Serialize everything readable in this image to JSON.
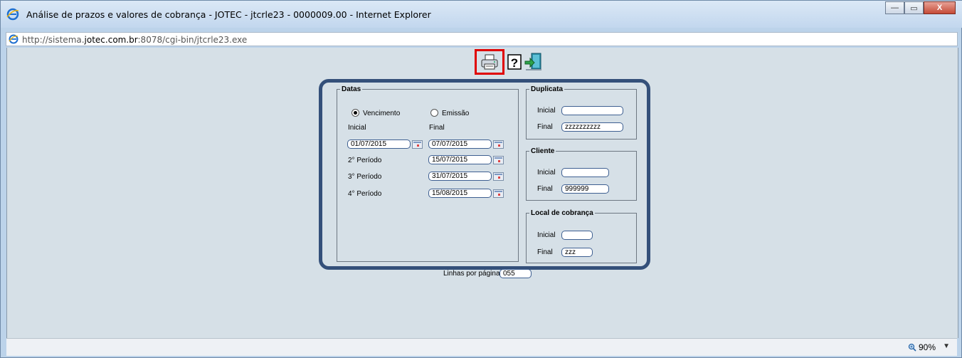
{
  "window": {
    "title": "Análise de prazos e valores de cobrança - JOTEC - jtcrle23 - 0000009.00 - Internet Explorer",
    "minimize": "—",
    "maximize": "▭",
    "close": "X"
  },
  "address": {
    "prefix": "http://sistema.",
    "domain": "jotec.com.br",
    "suffix": ":8078/cgi-bin/jtcrle23.exe"
  },
  "toolbar": {
    "print_icon": "printer-icon",
    "help_icon": "help-icon",
    "exit_icon": "exit-icon",
    "highlight_color": "#e00000"
  },
  "datas": {
    "legend": "Datas",
    "radio_vencimento": "Vencimento",
    "radio_emissao": "Emissão",
    "selected": "Vencimento",
    "col_inicial": "Inicial",
    "col_final": "Final",
    "inicial_value": "01/07/2015",
    "final_value": "07/07/2015",
    "periodo2_label": "2° Período",
    "periodo2_value": "15/07/2015",
    "periodo3_label": "3° Período",
    "periodo3_value": "31/07/2015",
    "periodo4_label": "4° Período",
    "periodo4_value": "15/08/2015"
  },
  "duplicata": {
    "legend": "Duplicata",
    "inicial_label": "Inicial",
    "inicial_value": "",
    "final_label": "Final",
    "final_value": "zzzzzzzzzz"
  },
  "cliente": {
    "legend": "Cliente",
    "inicial_label": "Inicial",
    "inicial_value": "",
    "final_label": "Final",
    "final_value": "999999"
  },
  "local": {
    "legend": "Local de cobrança",
    "inicial_label": "Inicial",
    "inicial_value": "",
    "final_label": "Final",
    "final_value": "zzz"
  },
  "linhas": {
    "label": "Linhas por página:",
    "value": "055"
  },
  "status": {
    "zoom": "90%"
  },
  "colors": {
    "panel_border": "#34507a",
    "content_bg": "#d6e0e7"
  }
}
